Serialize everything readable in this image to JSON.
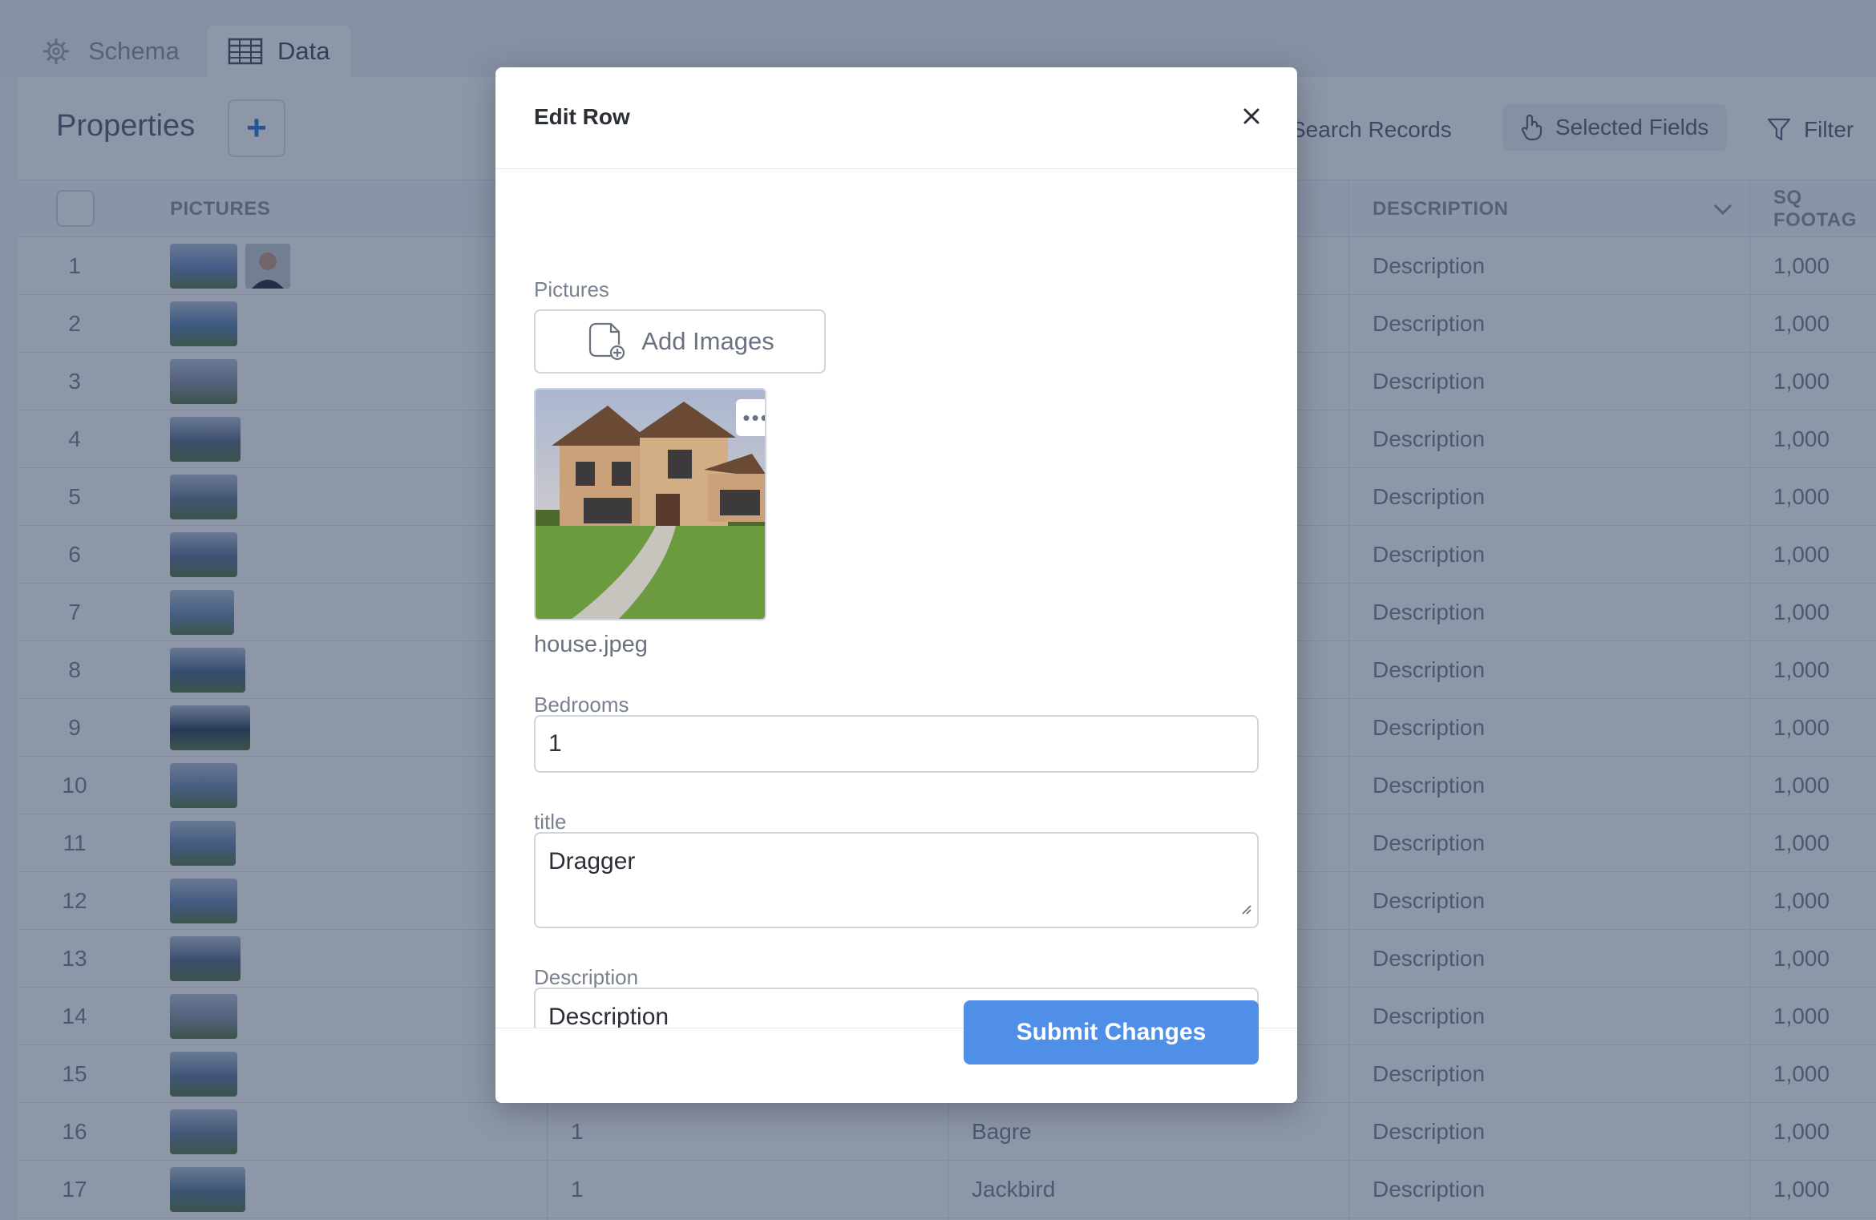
{
  "tabs": [
    {
      "label": "Schema",
      "icon": "database-gear-icon"
    },
    {
      "label": "Data",
      "icon": "table-icon",
      "active": true
    }
  ],
  "table_name": "Properties",
  "add_label": "+",
  "toolbar": {
    "search": "Search Records",
    "selected_fields": "Selected Fields",
    "filter": "Filter"
  },
  "columns": {
    "pictures": "PICTURES",
    "description": "DESCRIPTION",
    "sq_footage": "SQ FOOTAG"
  },
  "rows": [
    {
      "n": "1",
      "bedrooms": "",
      "title": "",
      "description": "Description",
      "sq": "1,000"
    },
    {
      "n": "2",
      "bedrooms": "",
      "title": "",
      "description": "Description",
      "sq": "1,000"
    },
    {
      "n": "3",
      "bedrooms": "",
      "title": "",
      "description": "Description",
      "sq": "1,000"
    },
    {
      "n": "4",
      "bedrooms": "",
      "title": "",
      "description": "Description",
      "sq": "1,000"
    },
    {
      "n": "5",
      "bedrooms": "",
      "title": "",
      "description": "Description",
      "sq": "1,000"
    },
    {
      "n": "6",
      "bedrooms": "",
      "title": "",
      "description": "Description",
      "sq": "1,000"
    },
    {
      "n": "7",
      "bedrooms": "",
      "title": "",
      "description": "Description",
      "sq": "1,000"
    },
    {
      "n": "8",
      "bedrooms": "",
      "title": "",
      "description": "Description",
      "sq": "1,000"
    },
    {
      "n": "9",
      "bedrooms": "",
      "title": "",
      "description": "Description",
      "sq": "1,000"
    },
    {
      "n": "10",
      "bedrooms": "",
      "title": "",
      "description": "Description",
      "sq": "1,000"
    },
    {
      "n": "11",
      "bedrooms": "",
      "title": "",
      "description": "Description",
      "sq": "1,000"
    },
    {
      "n": "12",
      "bedrooms": "",
      "title": "",
      "description": "Description",
      "sq": "1,000"
    },
    {
      "n": "13",
      "bedrooms": "",
      "title": "",
      "description": "Description",
      "sq": "1,000"
    },
    {
      "n": "14",
      "bedrooms": "",
      "title": "",
      "description": "Description",
      "sq": "1,000"
    },
    {
      "n": "15",
      "bedrooms": "",
      "title": "",
      "description": "Description",
      "sq": "1,000"
    },
    {
      "n": "16",
      "bedrooms": "1",
      "title": "Bagre",
      "description": "Description",
      "sq": "1,000"
    },
    {
      "n": "17",
      "bedrooms": "1",
      "title": "Jackbird",
      "description": "Description",
      "sq": "1,000"
    }
  ],
  "modal": {
    "title": "Edit Row",
    "pictures_label": "Pictures",
    "add_images": "Add Images",
    "image_filename": "house.jpeg",
    "image_menu": "•••",
    "bedrooms_label": "Bedrooms",
    "bedrooms_value": "1",
    "title_label": "title",
    "title_value": "Dragger",
    "description_label": "Description",
    "description_value": "Description",
    "submit": "Submit Changes"
  },
  "colors": {
    "accent": "#4f8fe8",
    "overlay": "#1c3052"
  }
}
